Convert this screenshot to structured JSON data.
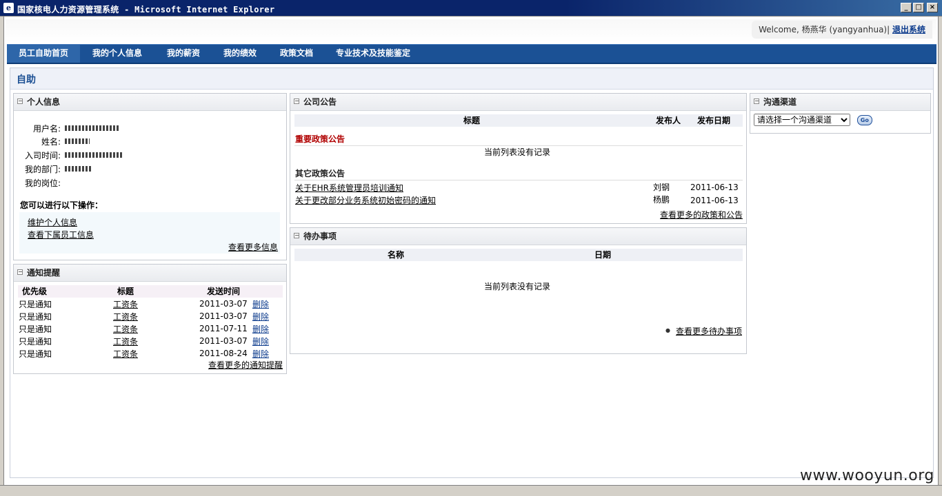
{
  "window": {
    "title": "国家核电人力资源管理系统 - Microsoft Internet Explorer",
    "minimize": "_",
    "maximize": "□",
    "close": "×"
  },
  "header": {
    "welcome_text": "Welcome, 杨燕华 (yangyanhua)|",
    "logout": "退出系统"
  },
  "nav": {
    "items": [
      {
        "label": "员工自助首页"
      },
      {
        "label": "我的个人信息"
      },
      {
        "label": "我的薪资"
      },
      {
        "label": "我的绩效"
      },
      {
        "label": "政策文档"
      },
      {
        "label": "专业技术及技能鉴定"
      }
    ],
    "active_index": 0
  },
  "page": {
    "title": "自助"
  },
  "personal_info": {
    "title": "个人信息",
    "toggle": "−",
    "fields": [
      {
        "label": "用户名:"
      },
      {
        "label": "姓名:"
      },
      {
        "label": "入司时间:"
      },
      {
        "label": "我的部门:"
      },
      {
        "label": "我的岗位:"
      }
    ],
    "ops_title": "您可以进行以下操作：",
    "ops": [
      {
        "label": "维护个人信息"
      },
      {
        "label": "查看下属员工信息"
      }
    ],
    "more": "查看更多信息"
  },
  "notifications": {
    "title": "通知提醒",
    "toggle": "−",
    "columns": {
      "priority": "优先级",
      "subject": "标题",
      "time": "发送时间"
    },
    "rows": [
      {
        "priority": "只是通知",
        "subject": "工资条",
        "time": "2011-03-07",
        "action": "删除"
      },
      {
        "priority": "只是通知",
        "subject": "工资条",
        "time": "2011-03-07",
        "action": "删除"
      },
      {
        "priority": "只是通知",
        "subject": "工资条",
        "time": "2011-07-11",
        "action": "删除"
      },
      {
        "priority": "只是通知",
        "subject": "工资条",
        "time": "2011-03-07",
        "action": "删除"
      },
      {
        "priority": "只是通知",
        "subject": "工资条",
        "time": "2011-08-24",
        "action": "删除"
      }
    ],
    "more": "查看更多的通知提醒"
  },
  "announcements": {
    "title": "公司公告",
    "toggle": "−",
    "columns": {
      "subject": "标题",
      "publisher": "发布人",
      "date": "发布日期"
    },
    "important_title": "重要政策公告",
    "empty_text": "当前列表没有记录",
    "other_title": "其它政策公告",
    "rows": [
      {
        "subject": "关于EHR系统管理员培训通知",
        "publisher": "刘钢",
        "date": "2011-06-13"
      },
      {
        "subject": "关于更改部分业务系统初始密码的通知",
        "publisher": "杨鹏",
        "date": "2011-06-13"
      }
    ],
    "more": "查看更多的政策和公告"
  },
  "todo": {
    "title": "待办事项",
    "toggle": "−",
    "columns": {
      "name": "名称",
      "date": "日期"
    },
    "empty_text": "当前列表没有记录",
    "bullet": "●",
    "more": "查看更多待办事项"
  },
  "channels": {
    "title": "沟通渠道",
    "toggle": "−",
    "select_value": "请选择一个沟通渠道",
    "go_label": "Go"
  },
  "watermark": "www.wooyun.org"
}
